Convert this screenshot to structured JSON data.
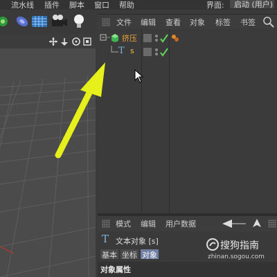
{
  "menubar": {
    "items": [
      "流水线",
      "插件",
      "脚本",
      "窗口",
      "帮助"
    ],
    "layout_label": "界面:",
    "layout_value": "启动 (用户)"
  },
  "object_manager": {
    "menu": [
      "文件",
      "编辑",
      "查看",
      "对象",
      "标签",
      "书签"
    ],
    "objects": [
      {
        "name": "挤压",
        "color": "#e8a33a"
      },
      {
        "name": "s",
        "color": "#e8c23a"
      }
    ]
  },
  "attribute_manager": {
    "menu": [
      "模式",
      "编辑",
      "用户数据"
    ],
    "object_title": "文本对象 [s]",
    "tabs": [
      "基本",
      "坐标",
      "对象"
    ],
    "active_tab": "对象",
    "section_title": "对象属性"
  },
  "watermark": {
    "brand": "搜狗指南",
    "url": "zhinan.sogou.com"
  },
  "colors": {
    "accent_arrow": "#e6f01a",
    "check": "#5fd35f",
    "active_tab": "#6e7da0"
  }
}
